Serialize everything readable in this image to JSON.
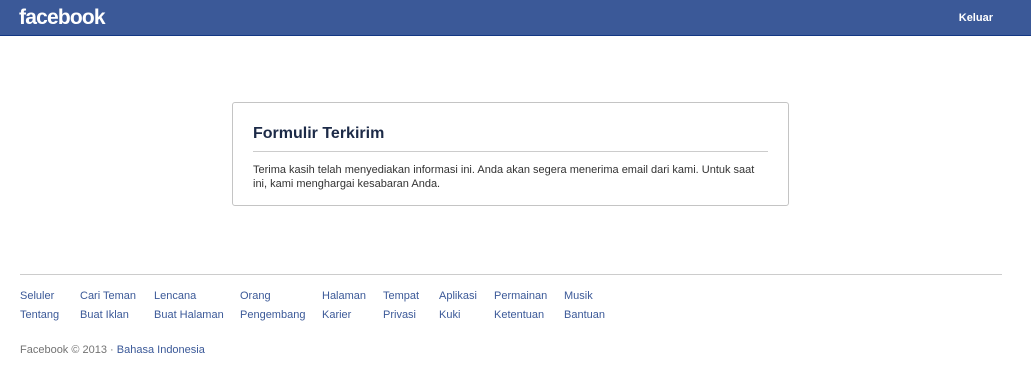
{
  "header": {
    "logo_text": "facebook",
    "logout_label": "Keluar",
    "brand_color": "#3b5998"
  },
  "card": {
    "title": "Formulir Terkirim",
    "body": "Terima kasih telah menyediakan informasi ini. Anda akan segera menerima email dari kami. Untuk saat ini, kami menghargai kesabaran Anda."
  },
  "footer": {
    "columns": [
      [
        "Seluler",
        "Tentang"
      ],
      [
        "Cari Teman",
        "Buat Iklan"
      ],
      [
        "Lencana",
        "Buat Halaman"
      ],
      [
        "Orang",
        "Pengembang"
      ],
      [
        "Halaman",
        "Karier"
      ],
      [
        "Tempat",
        "Privasi"
      ],
      [
        "Aplikasi",
        "Kuki"
      ],
      [
        "Permainan",
        "Ketentuan"
      ],
      [
        "Musik",
        "Bantuan"
      ]
    ],
    "copyright": "Facebook © 2013 · ",
    "language": "Bahasa Indonesia"
  }
}
